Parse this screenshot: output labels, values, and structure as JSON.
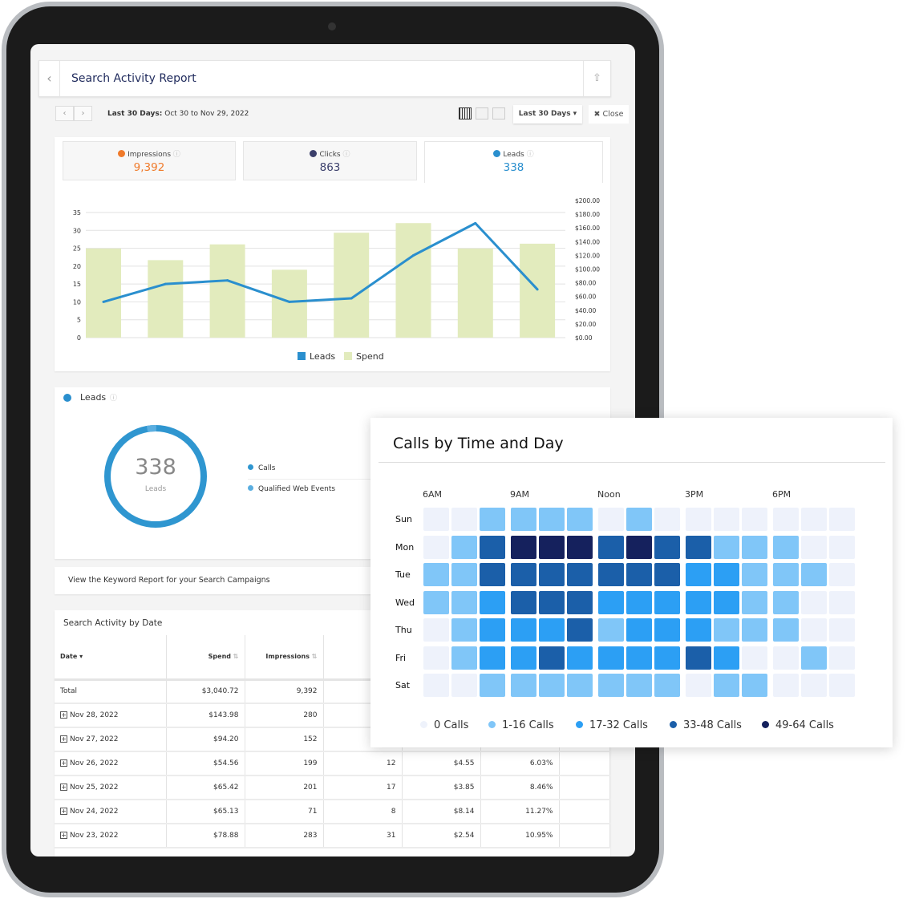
{
  "header": {
    "title": "Search Activity Report",
    "back_icon": "chevron-left-icon",
    "share_icon": "share-icon"
  },
  "toolbar": {
    "range_label": "Last 30 Days:",
    "range_value": "Oct 30 to Nov 29, 2022",
    "dropdown": "Last 30 Days",
    "close": "Close"
  },
  "kpis": [
    {
      "label": "Impressions",
      "value": "9,392",
      "color": "#f07a2a"
    },
    {
      "label": "Clicks",
      "value": "863",
      "color": "#3b3f6b"
    },
    {
      "label": "Leads",
      "value": "338",
      "color": "#2a8fce",
      "active": true
    }
  ],
  "chart_data": {
    "type": "bar+line",
    "series": [
      {
        "name": "Leads",
        "type": "line",
        "axis": "left",
        "color": "#2a8fce",
        "values": [
          10,
          15,
          16,
          10,
          11,
          23,
          32,
          13.5
        ]
      },
      {
        "name": "Spend",
        "type": "bar",
        "axis": "right",
        "color": "#e2ebbd",
        "values": [
          130,
          113,
          136,
          99,
          153,
          167,
          130,
          137
        ]
      }
    ],
    "left_axis": {
      "ylim": [
        0,
        35
      ],
      "ticks": [
        "0",
        "5",
        "10",
        "15",
        "20",
        "25",
        "30",
        "35"
      ]
    },
    "right_axis": {
      "ylim": [
        0,
        200
      ],
      "ticks": [
        "$0.00",
        "$20.00",
        "$40.00",
        "$60.00",
        "$80.00",
        "$100.00",
        "$120.00",
        "$140.00",
        "$160.00",
        "$180.00",
        "$200.00"
      ]
    },
    "grid": true,
    "legend": "bottom"
  },
  "leads_panel": {
    "title": "Leads",
    "total": "338",
    "total_label": "Leads",
    "legend": [
      {
        "label": "Calls",
        "color": "#2f96d0"
      },
      {
        "label": "Qualified Web Events",
        "color": "#5aaee0"
      }
    ],
    "calls_fraction": 0.97
  },
  "keyword_link": "View the Keyword Report for your Search Campaigns",
  "table": {
    "title": "Search Activity by Date",
    "headers": [
      "Date",
      "Spend",
      "Impressions",
      "",
      "",
      "",
      ""
    ],
    "total": [
      "Total",
      "$3,040.72",
      "9,392",
      "",
      "",
      "",
      ""
    ],
    "rows": [
      [
        "Nov 28, 2022",
        "$143.98",
        "280",
        "",
        "",
        "",
        ""
      ],
      [
        "Nov 27, 2022",
        "$94.20",
        "152",
        "",
        "",
        "",
        ""
      ],
      [
        "Nov 26, 2022",
        "$54.56",
        "199",
        "12",
        "$4.55",
        "6.03%",
        ""
      ],
      [
        "Nov 25, 2022",
        "$65.42",
        "201",
        "17",
        "$3.85",
        "8.46%",
        ""
      ],
      [
        "Nov 24, 2022",
        "$65.13",
        "71",
        "8",
        "$8.14",
        "11.27%",
        ""
      ],
      [
        "Nov 23, 2022",
        "$78.88",
        "283",
        "31",
        "$2.54",
        "10.95%",
        ""
      ]
    ]
  },
  "heatmap": {
    "title": "Calls by Time and Day",
    "hours": [
      "6AM",
      "9AM",
      "Noon",
      "3PM",
      "6PM"
    ],
    "days": [
      "Sun",
      "Mon",
      "Tue",
      "Wed",
      "Thu",
      "Fri",
      "Sat"
    ],
    "levels": [
      [
        0,
        0,
        1,
        1,
        1,
        1,
        0,
        1,
        0,
        0,
        0,
        0,
        0,
        0,
        0
      ],
      [
        0,
        1,
        3,
        4,
        4,
        4,
        3,
        4,
        3,
        3,
        1,
        1,
        1,
        0,
        0
      ],
      [
        1,
        1,
        3,
        3,
        3,
        3,
        3,
        3,
        3,
        2,
        2,
        1,
        1,
        1,
        0
      ],
      [
        1,
        1,
        2,
        3,
        3,
        3,
        2,
        2,
        2,
        2,
        2,
        1,
        1,
        0,
        0
      ],
      [
        0,
        1,
        2,
        2,
        2,
        3,
        1,
        2,
        2,
        2,
        1,
        1,
        1,
        0,
        0
      ],
      [
        0,
        1,
        2,
        2,
        3,
        2,
        2,
        2,
        2,
        3,
        2,
        0,
        0,
        1,
        0
      ],
      [
        0,
        0,
        1,
        1,
        1,
        1,
        1,
        1,
        1,
        0,
        1,
        1,
        0,
        0,
        0
      ]
    ],
    "legend": [
      {
        "label": "0 Calls",
        "color": "#eef2fb"
      },
      {
        "label": "1-16 Calls",
        "color": "#80c6f8"
      },
      {
        "label": "17-32 Calls",
        "color": "#2c9ff4"
      },
      {
        "label": "33-48 Calls",
        "color": "#1b5fa9"
      },
      {
        "label": "49-64 Calls",
        "color": "#15215d"
      }
    ]
  }
}
